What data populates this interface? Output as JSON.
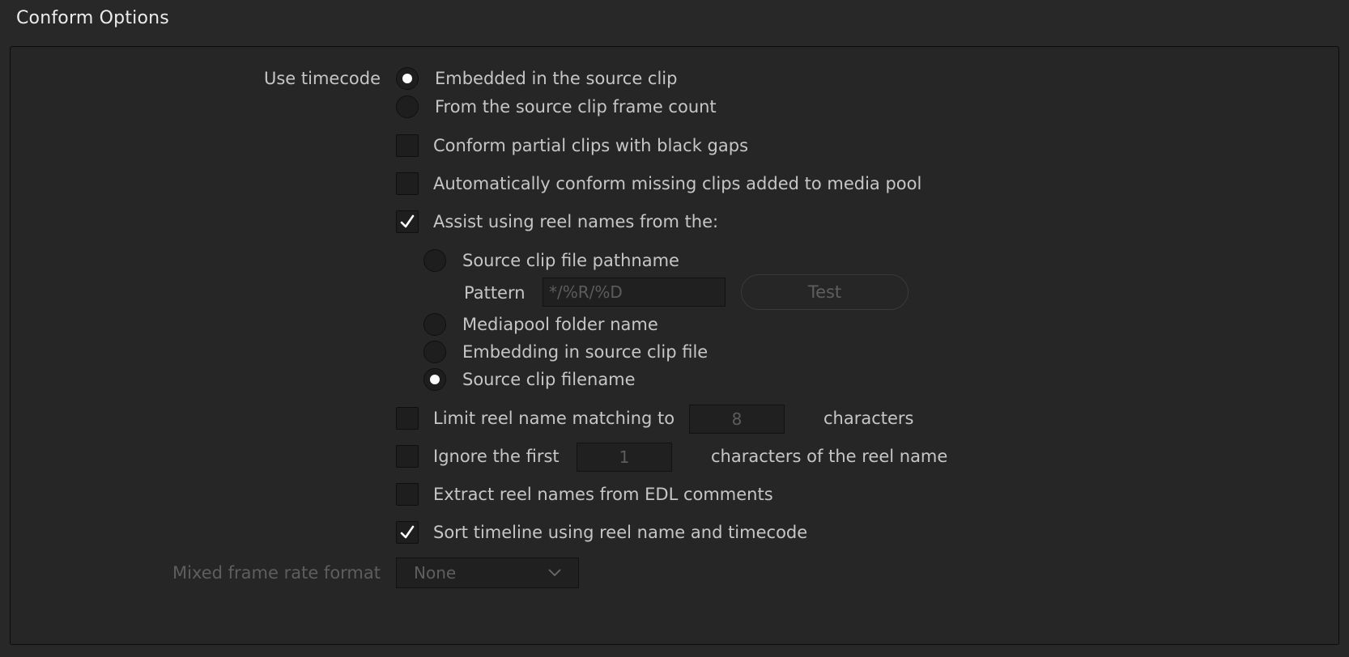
{
  "title": "Conform Options",
  "use_timecode": {
    "label": "Use timecode",
    "options": [
      {
        "label": "Embedded in the source clip",
        "selected": true
      },
      {
        "label": "From the source clip frame count",
        "selected": false
      }
    ]
  },
  "checkboxes": {
    "partial_clips": {
      "label": "Conform partial clips with black gaps",
      "checked": false
    },
    "auto_conform": {
      "label": "Automatically conform missing clips added to media pool",
      "checked": false
    },
    "assist_reel": {
      "label": "Assist using reel names from the:",
      "checked": true
    }
  },
  "reel_source": {
    "options": [
      {
        "label": "Source clip file pathname",
        "selected": false
      },
      {
        "label": "Mediapool folder name",
        "selected": false
      },
      {
        "label": "Embedding in source clip file",
        "selected": false
      },
      {
        "label": "Source clip filename",
        "selected": true
      }
    ],
    "pattern_label": "Pattern",
    "pattern_value": "*/%R/%D",
    "test_button": "Test"
  },
  "limit_reel": {
    "label": "Limit reel name matching to",
    "value": "8",
    "suffix": "characters",
    "checked": false
  },
  "ignore_first": {
    "label": "Ignore the first",
    "value": "1",
    "suffix": "characters of the reel name",
    "checked": false
  },
  "extract_edl": {
    "label": "Extract reel names from EDL comments",
    "checked": false
  },
  "sort_timeline": {
    "label": "Sort timeline using reel name and timecode",
    "checked": true
  },
  "mixed_frame_rate": {
    "label": "Mixed frame rate format",
    "value": "None"
  },
  "icons": {
    "check": "checkmark-icon",
    "dropdown": "chevron-down-icon"
  }
}
